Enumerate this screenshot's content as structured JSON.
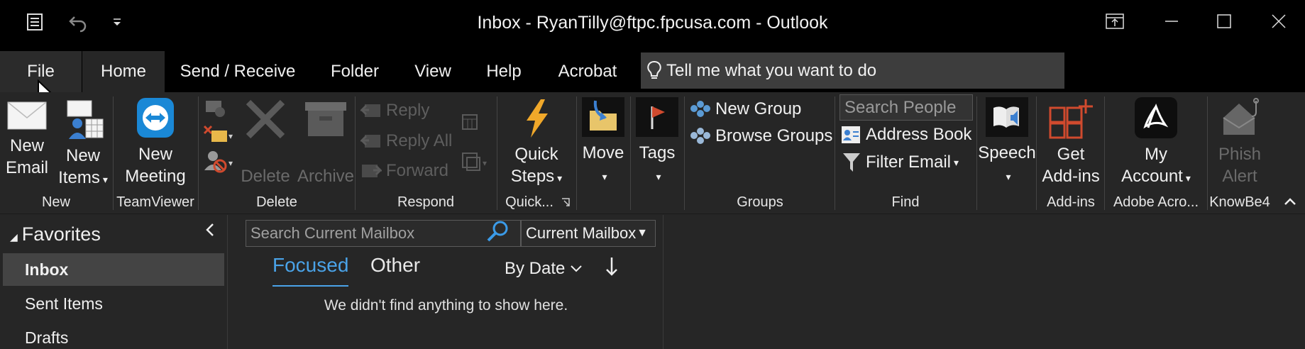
{
  "window": {
    "title": "Inbox - RyanTilly@ftpc.fpcusa.com  -  Outlook"
  },
  "tabs": [
    {
      "label": "File"
    },
    {
      "label": "Home"
    },
    {
      "label": "Send / Receive"
    },
    {
      "label": "Folder"
    },
    {
      "label": "View"
    },
    {
      "label": "Help"
    },
    {
      "label": "Acrobat"
    }
  ],
  "tell_me": {
    "placeholder": "Tell me what you want to do"
  },
  "ribbon": {
    "new": {
      "new_email": [
        "New",
        "Email"
      ],
      "new_items": [
        "New",
        "Items"
      ],
      "group": "New"
    },
    "teamviewer": {
      "new_meeting": [
        "New",
        "Meeting"
      ],
      "group": "TeamViewer"
    },
    "delete": {
      "delete_label": "Delete",
      "archive_label": "Archive",
      "group": "Delete"
    },
    "respond": {
      "reply": "Reply",
      "reply_all": "Reply All",
      "forward": "Forward",
      "group": "Respond"
    },
    "quick": {
      "label": [
        "Quick",
        "Steps"
      ],
      "group": "Quick..."
    },
    "move": {
      "label": "Move"
    },
    "tags": {
      "label": "Tags"
    },
    "groups": {
      "new_group": "New Group",
      "browse_groups": "Browse Groups",
      "group": "Groups"
    },
    "find": {
      "search_people": "Search People",
      "address_book": "Address Book",
      "filter_email": "Filter Email",
      "group": "Find"
    },
    "speech": {
      "label": "Speech"
    },
    "addins": {
      "label": [
        "Get",
        "Add-ins"
      ],
      "group": "Add-ins"
    },
    "adobe": {
      "label": [
        "My",
        "Account"
      ],
      "group": "Adobe Acro..."
    },
    "knowbe4": {
      "label": [
        "Phish",
        "Alert"
      ],
      "group": "KnowBe4"
    }
  },
  "folders": {
    "header": "Favorites",
    "items": [
      {
        "label": "Inbox",
        "selected": true
      },
      {
        "label": "Sent Items"
      },
      {
        "label": "Drafts"
      }
    ]
  },
  "list": {
    "search_placeholder": "Search Current Mailbox",
    "scope": "Current Mailbox",
    "focused": "Focused",
    "other": "Other",
    "sort": "By Date",
    "empty": "We didn't find anything to show here."
  },
  "colors": {
    "accent": "#4aa3e8",
    "background": "#262626",
    "titlebar": "#000000"
  }
}
